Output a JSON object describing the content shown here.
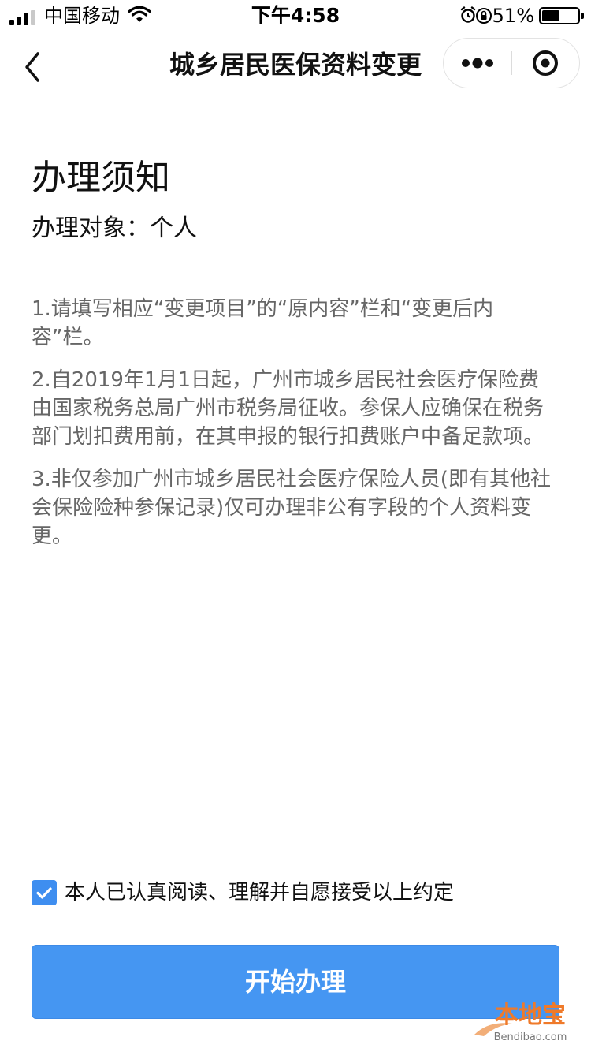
{
  "status_bar": {
    "carrier": "中国移动",
    "time": "下午4:58",
    "battery_percent": "51%",
    "battery_level": 0.51,
    "signal_bars_filled": 3,
    "signal_bars_total": 4
  },
  "nav": {
    "title": "城乡居民医保资料变更",
    "back_icon": "chevron-left-icon",
    "more_icon": "more-dots-icon",
    "close_icon": "target-close-icon"
  },
  "content": {
    "heading": "办理须知",
    "subject": "办理对象：个人",
    "notes": [
      "1.请填写相应“变更项目”的“原内容”栏和“变更后内容”栏。",
      "2.自2019年1月1日起，广州市城乡居民社会医疗保险费由国家税务总局广州市税务局征收。参保人应确保在税务部门划扣费用前，在其申报的银行扣费账户中备足款项。",
      "3.非仅参加广州市城乡居民社会医疗保险人员(即有其他社会保险险种参保记录)仅可办理非公有字段的个人资料变更。"
    ]
  },
  "agreement": {
    "checked": true,
    "text": "本人已认真阅读、理解并自愿接受以上约定"
  },
  "primary_button": {
    "label": "开始办理"
  },
  "watermark": {
    "text_cn": "本地宝",
    "text_en": "Bendibao.com"
  },
  "colors": {
    "accent": "#4596f2",
    "checkbox": "#3e8ef0",
    "note_text": "#666666",
    "watermark": "#ef7a2a"
  }
}
